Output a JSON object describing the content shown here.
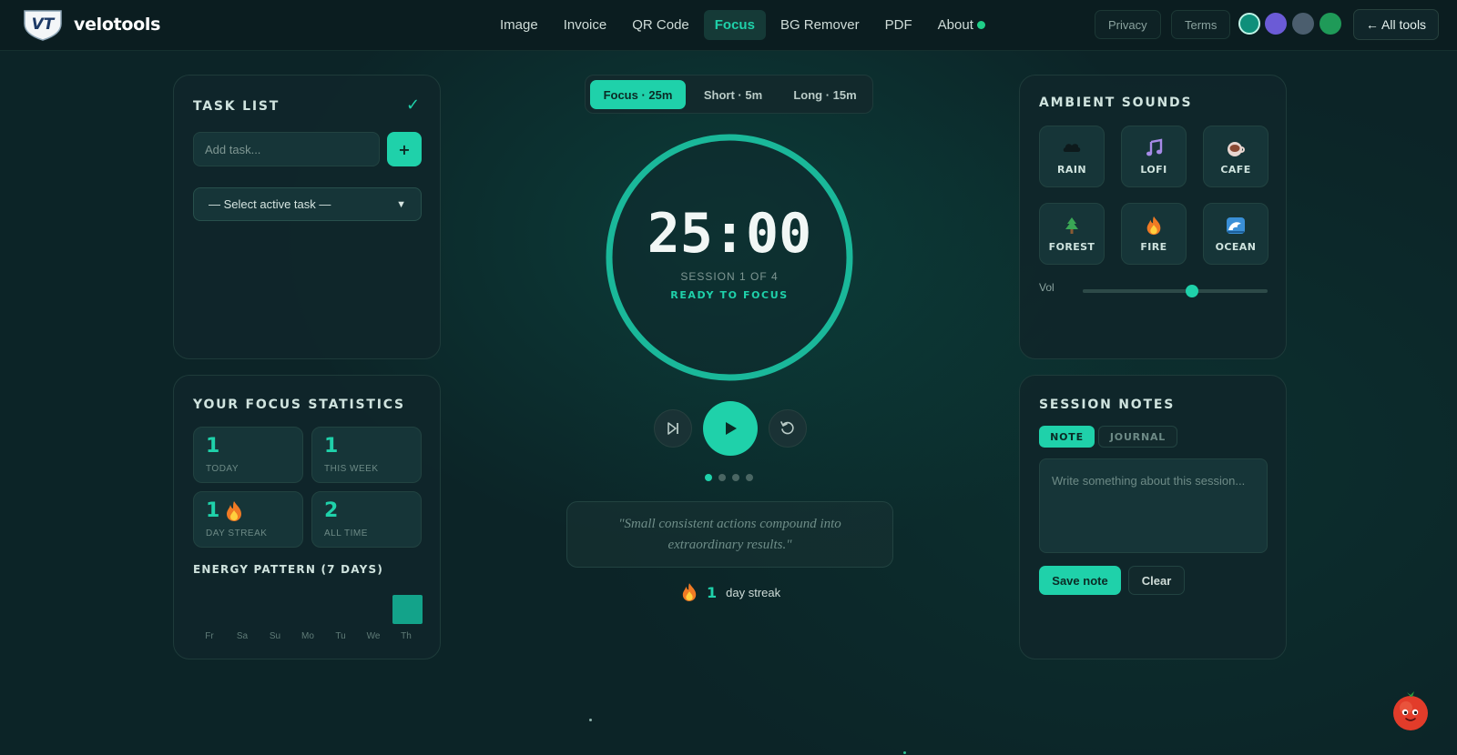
{
  "app": {
    "brand": "velotools",
    "logo_text": "VT"
  },
  "nav": {
    "items": [
      {
        "label": "Image",
        "active": false
      },
      {
        "label": "Invoice",
        "active": false
      },
      {
        "label": "QR Code",
        "active": false
      },
      {
        "label": "Focus",
        "active": true
      },
      {
        "label": "BG Remover",
        "active": false
      },
      {
        "label": "PDF",
        "active": false
      },
      {
        "label": "About",
        "active": false
      }
    ],
    "privacy_label": "Privacy",
    "terms_label": "Terms",
    "all_tools_label": "← All tools",
    "theme_swatches": [
      "#0e8f7a",
      "#6b5bd6",
      "#4b5e6e",
      "#1f9a58"
    ]
  },
  "task_list": {
    "title": "TASK LIST",
    "input_placeholder": "Add task...",
    "add_button_label": "+",
    "select_value": "— Select active task —"
  },
  "stats": {
    "title": "YOUR FOCUS STATISTICS",
    "cards": [
      {
        "value": "1",
        "label": "TODAY",
        "icon": ""
      },
      {
        "value": "1",
        "label": "THIS WEEK",
        "icon": ""
      },
      {
        "value": "1",
        "label": "DAY STREAK",
        "icon": "flame-icon"
      },
      {
        "value": "2",
        "label": "ALL TIME",
        "icon": ""
      }
    ],
    "energy_title": "ENERGY PATTERN (7 DAYS)",
    "energy_days": [
      "Fr",
      "Sa",
      "Su",
      "Mo",
      "Tu",
      "We",
      "Th"
    ],
    "energy_values": [
      0,
      0,
      0,
      0,
      0,
      0,
      1
    ]
  },
  "timer": {
    "modes": [
      {
        "label": "Focus · 25m",
        "active": true
      },
      {
        "label": "Short · 5m",
        "active": false
      },
      {
        "label": "Long · 15m",
        "active": false
      }
    ],
    "time": "25:00",
    "session": "SESSION 1 OF 4",
    "status": "READY TO FOCUS",
    "progress": 1.0,
    "session_dots": 4,
    "current_dot": 1,
    "quote": "\"Small consistent actions compound into extraordinary results.\"",
    "streak_value": "1",
    "streak_label": "day streak"
  },
  "ambient": {
    "title": "AMBIENT SOUNDS",
    "sounds": [
      {
        "label": "RAIN",
        "icon": "cloud-icon"
      },
      {
        "label": "LOFI",
        "icon": "music-icon"
      },
      {
        "label": "CAFE",
        "icon": "coffee-icon"
      },
      {
        "label": "FOREST",
        "icon": "tree-icon"
      },
      {
        "label": "FIRE",
        "icon": "flame-icon"
      },
      {
        "label": "OCEAN",
        "icon": "wave-icon"
      }
    ],
    "volume_label": "Vol",
    "volume": 0.59
  },
  "notes": {
    "title": "SESSION NOTES",
    "tabs": [
      {
        "label": "NOTE",
        "active": true
      },
      {
        "label": "JOURNAL",
        "active": false
      }
    ],
    "placeholder": "Write something about this session...",
    "save_label": "Save note",
    "clear_label": "Clear"
  },
  "colors": {
    "accent": "#1fd1aa",
    "background": "#0c2427",
    "panel": "#10262a"
  }
}
